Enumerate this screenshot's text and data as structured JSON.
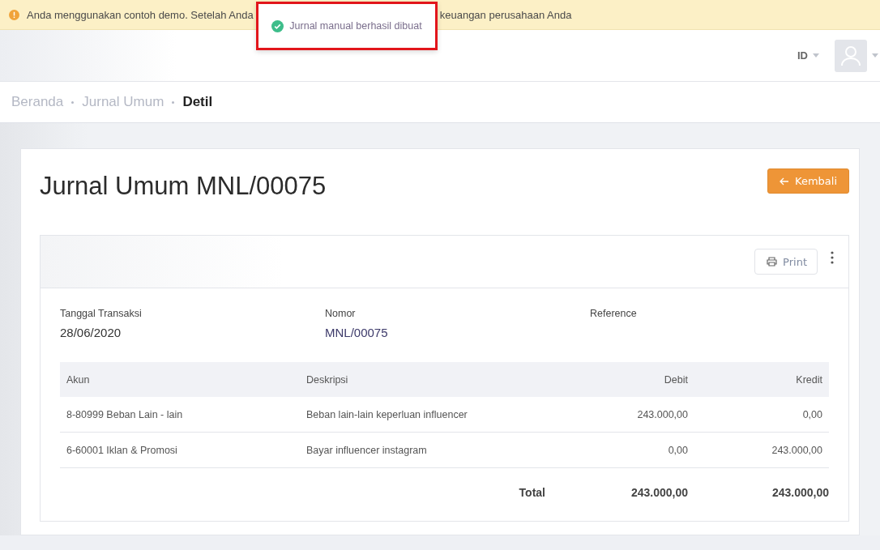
{
  "banner": {
    "text_start": "Anda menggunakan contoh demo. Setelah Anda",
    "text_end": "keuangan perusahaan Anda"
  },
  "toast": {
    "text": "Jurnal manual berhasil dibuat",
    "outlined": true
  },
  "header": {
    "language": "ID"
  },
  "breadcrumb": [
    {
      "label": "Beranda",
      "current": false
    },
    {
      "label": "Jurnal Umum",
      "current": false
    },
    {
      "label": "Detil",
      "current": true
    }
  ],
  "page": {
    "title": "Jurnal Umum MNL/00075",
    "back_button": "Kembali"
  },
  "toolbar": {
    "print_button": "Print"
  },
  "fields": [
    {
      "label": "Tanggal Transaksi",
      "value": "28/06/2020"
    },
    {
      "label": "Nomor",
      "value": "MNL/00075"
    },
    {
      "label": "Reference"
    }
  ],
  "table": {
    "columns": [
      "Akun",
      "Deskripsi",
      "Debit",
      "Kredit"
    ],
    "rows": [
      [
        "8-80999 Beban Lain - lain",
        "Beban lain-lain keperluan influencer",
        "243.000,00",
        "0,00"
      ],
      [
        "6-60001 Iklan & Promosi",
        "Bayar influencer instagram",
        "0,00",
        "243.000,00"
      ]
    ],
    "total": {
      "label": "Total",
      "debit": "243.000,00",
      "kredit": "243.000,00"
    }
  }
}
